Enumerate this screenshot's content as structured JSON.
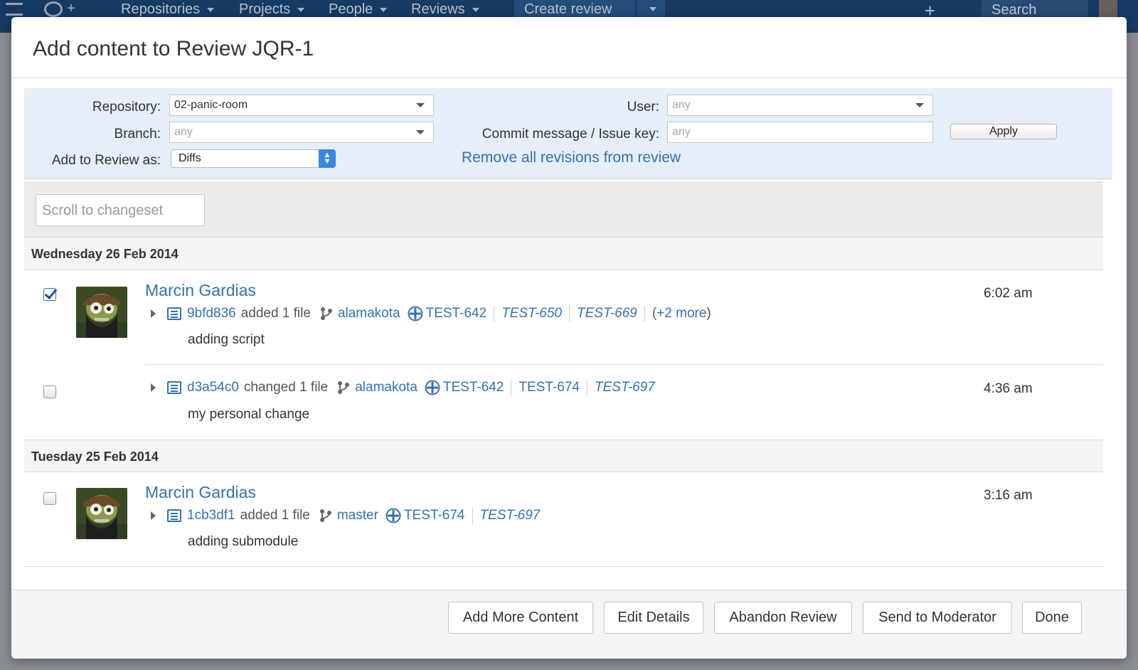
{
  "app_nav": {
    "items": [
      {
        "label": "Repositories"
      },
      {
        "label": "Projects"
      },
      {
        "label": "People"
      },
      {
        "label": "Reviews"
      }
    ],
    "create_label": "Create review",
    "plus": "+",
    "search_placeholder": "Search"
  },
  "dialog": {
    "title": "Add content to Review JQR-1"
  },
  "filters": {
    "repository_label": "Repository:",
    "repository_value": "02-panic-room",
    "branch_label": "Branch:",
    "branch_value": "any",
    "add_as_label": "Add to Review as:",
    "add_as_value": "Diffs",
    "user_label": "User:",
    "user_value": "any",
    "commit_label": "Commit message / Issue key:",
    "commit_placeholder": "any",
    "apply_label": "Apply",
    "remove_all_label": "Remove all revisions from review"
  },
  "scroll": {
    "placeholder": "Scroll to changeset"
  },
  "days": [
    {
      "header": "Wednesday 26 Feb 2014",
      "commits": [
        {
          "checked": true,
          "author": "Marcin Gardias",
          "changeset": "9bfd836",
          "action": "added 1 file",
          "branch": "alamakota",
          "issues": [
            "TEST-642",
            "TEST-650",
            "TEST-669"
          ],
          "more": "+2 more",
          "message": "adding script",
          "time": "6:02 am"
        },
        {
          "checked": false,
          "author": "",
          "changeset": "d3a54c0",
          "action": "changed 1 file",
          "branch": "alamakota",
          "issues": [
            "TEST-642",
            "TEST-674",
            "TEST-697"
          ],
          "message": "my personal change",
          "time": "4:36 am"
        }
      ]
    },
    {
      "header": "Tuesday 25 Feb 2014",
      "commits": [
        {
          "checked": false,
          "author": "Marcin Gardias",
          "changeset": "1cb3df1",
          "action": "added 1 file",
          "branch": "master",
          "issues": [
            "TEST-674",
            "TEST-697"
          ],
          "message": "adding submodule",
          "time": "3:16 am"
        }
      ]
    }
  ],
  "footer": {
    "add_more": "Add More Content",
    "edit_details": "Edit Details",
    "abandon": "Abandon Review",
    "send_moderator": "Send to Moderator",
    "done": "Done"
  },
  "colors": {
    "link": "#3572b0",
    "nav_bg": "#173a63",
    "filter_bg": "#e6eef9"
  }
}
